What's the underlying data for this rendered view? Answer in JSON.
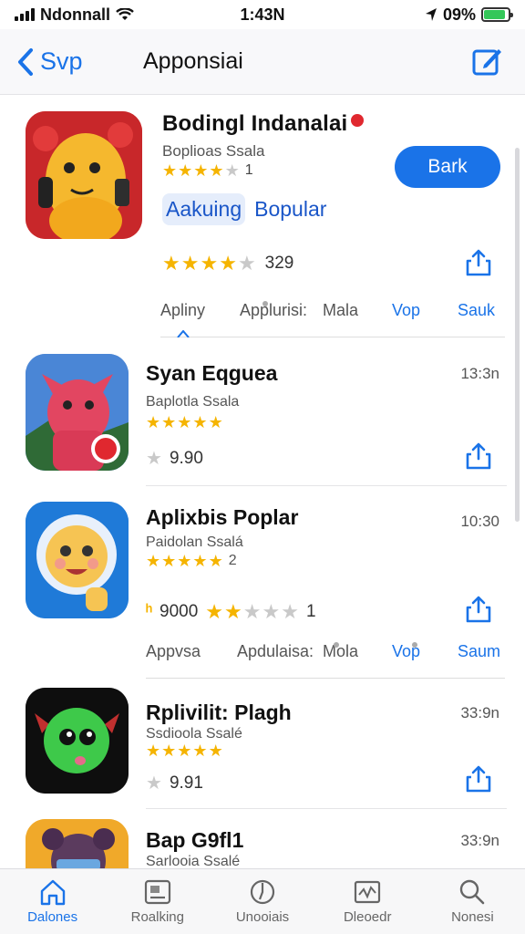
{
  "status_bar": {
    "carrier": "Ndonnall",
    "time": "1:43N",
    "battery": "09%",
    "battery_level": 0.9
  },
  "nav": {
    "back_label": "Svp",
    "title": "Apponsiai"
  },
  "featured": {
    "name": "Bodingl Indanalai",
    "subtitle": "Boplioas Ssala",
    "rating_count": "1",
    "rating_stars": 3.5,
    "get_label": "Bark",
    "tags": [
      "Aakuing",
      "Bopular"
    ],
    "rating2_stars": 4,
    "rating2_count": "329",
    "segments": [
      "Apliny",
      "Applurisi:",
      "Mala",
      "Vop",
      "Sauk"
    ]
  },
  "apps": [
    {
      "name": "Syan Eqguea",
      "subtitle": "Baplotla Ssala",
      "stars": 4.5,
      "rating_text": "",
      "meta": "9.90",
      "time": "13:3n"
    },
    {
      "name": "Aplixbis Poplar",
      "subtitle": "Paidolan Ssalá",
      "stars": 4.5,
      "rating_text": "2",
      "meta": "9000",
      "meta_extra": "1",
      "time": "10:30",
      "segments": [
        "Appvsa",
        "Apdulaisa:",
        "Mola",
        "Vop",
        "Saum"
      ]
    },
    {
      "name": "Rplivilit: Plagh",
      "subtitle": "Ssdioola Ssalé",
      "stars": 5,
      "rating_text": "",
      "meta": "9.91",
      "time": "33:9n"
    },
    {
      "name": "Bap G9fl1",
      "subtitle": "Sarlooia Ssalé",
      "time": "33:9n"
    }
  ],
  "tabs": [
    {
      "label": "Dalones",
      "icon": "home-icon",
      "active": true
    },
    {
      "label": "Roalking",
      "icon": "ranking-icon",
      "active": false
    },
    {
      "label": "Unooiais",
      "icon": "compass-icon",
      "active": false
    },
    {
      "label": "Dleoedr",
      "icon": "chart-icon",
      "active": false
    },
    {
      "label": "Nonesi",
      "icon": "search-icon",
      "active": false
    }
  ],
  "colors": {
    "accent": "#1a73e8",
    "star": "#f5b400",
    "badge": "#e0282f"
  }
}
